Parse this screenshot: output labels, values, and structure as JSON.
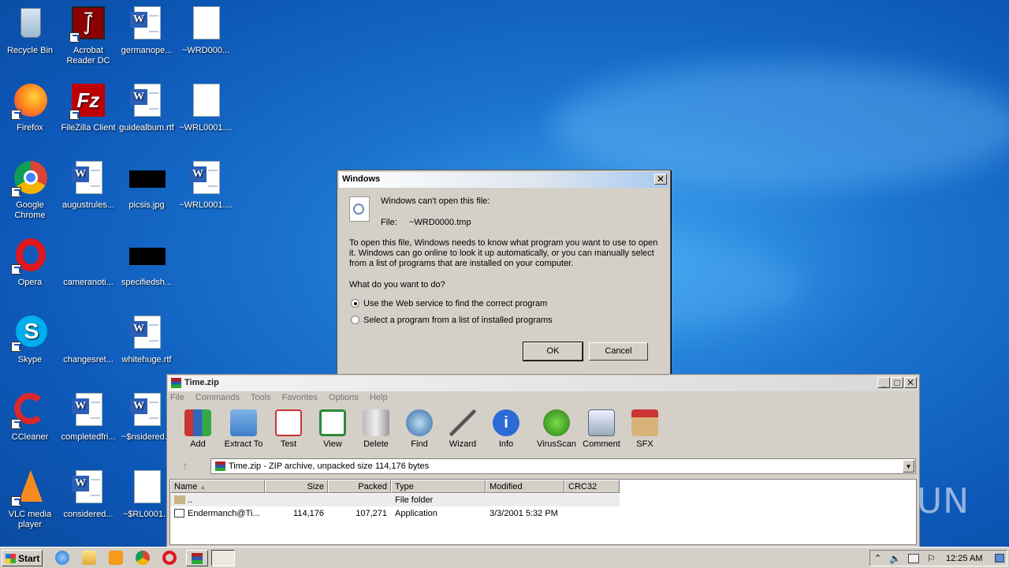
{
  "desktop": {
    "icons": [
      {
        "label": "Recycle Bin"
      },
      {
        "label": "Acrobat Reader DC"
      },
      {
        "label": "germanope..."
      },
      {
        "label": "~WRD000..."
      },
      {
        "label": "Firefox"
      },
      {
        "label": "FileZilla Client"
      },
      {
        "label": "guidealbum.rtf"
      },
      {
        "label": "~WRL0001...."
      },
      {
        "label": "Google Chrome"
      },
      {
        "label": "augustrules..."
      },
      {
        "label": "picsis.jpg"
      },
      {
        "label": "~WRL0001...."
      },
      {
        "label": "Opera"
      },
      {
        "label": "cameranoti..."
      },
      {
        "label": "specifiedsh..."
      },
      {
        "label": "Skype"
      },
      {
        "label": "changesret..."
      },
      {
        "label": "whitehuge.rtf"
      },
      {
        "label": "CCleaner"
      },
      {
        "label": "completedfri..."
      },
      {
        "label": "~$nsidered..."
      },
      {
        "label": "VLC media player"
      },
      {
        "label": "considered..."
      },
      {
        "label": "~$RL0001..."
      }
    ]
  },
  "dialog": {
    "title": "Windows",
    "message": "Windows can't open this file:",
    "file_label": "File:",
    "file_name": "~WRD0000.tmp",
    "description": "To open this file, Windows needs to know what program you want to use to open it. Windows can go online to look it up automatically, or you can manually select from a list of programs that are installed on your computer.",
    "question": "What do you want to do?",
    "option_web": "Use the Web service to find the correct program",
    "option_list": "Select a program from a list of installed programs",
    "ok_label": "OK",
    "cancel_label": "Cancel"
  },
  "winrar": {
    "title": "Time.zip",
    "menu": [
      "File",
      "Commands",
      "Tools",
      "Favorites",
      "Options",
      "Help"
    ],
    "toolbar": [
      "Add",
      "Extract To",
      "Test",
      "View",
      "Delete",
      "Find",
      "Wizard",
      "Info",
      "VirusScan",
      "Comment",
      "SFX"
    ],
    "address": "Time.zip - ZIP archive, unpacked size 114,176 bytes",
    "columns": [
      "Name",
      "Size",
      "Packed",
      "Type",
      "Modified",
      "CRC32"
    ],
    "rows": [
      {
        "name": "..",
        "size": "",
        "packed": "",
        "type": "File folder",
        "modified": "",
        "crc": ""
      },
      {
        "name": "Endermanch@Ti...",
        "size": "114,176",
        "packed": "107,271",
        "type": "Application",
        "modified": "3/3/2001 5:32 PM",
        "crc": ""
      }
    ]
  },
  "taskbar": {
    "start_label": "Start",
    "clock": "12:25 AM"
  },
  "watermark": "ANY RUN"
}
